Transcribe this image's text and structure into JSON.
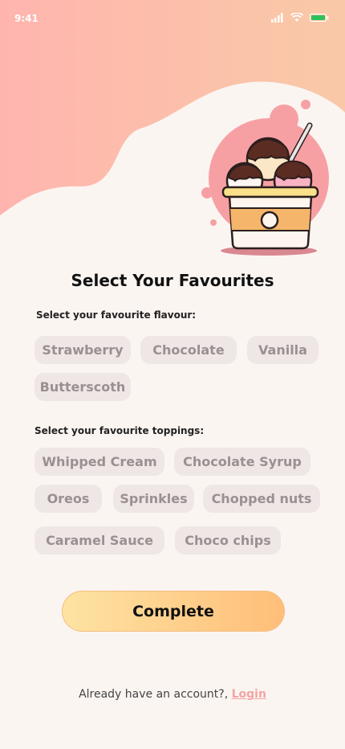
{
  "status_bar": {
    "time": "9:41",
    "icons": [
      "signal-icon",
      "wifi-icon",
      "battery-icon"
    ]
  },
  "colors": {
    "background": "#fbf5f2",
    "wave_gradient_start": "#ffb5ae",
    "wave_gradient_end": "#f9c9a7",
    "chip_background": "#efe6e6",
    "chip_text": "#9a8f91",
    "button_gradient_start": "#fde3a2",
    "button_gradient_end": "#ffbe79",
    "link": "#f4a3a3"
  },
  "illustration": {
    "icon": "ice-cream-cup-icon"
  },
  "title": "Select Your Favourites",
  "flavour_section": {
    "label": "Select your favourite flavour:",
    "options": [
      "Strawberry",
      "Chocolate",
      "Vanilla",
      "Butterscoth"
    ]
  },
  "toppings_section": {
    "label": "Select your favourite toppings:",
    "options": [
      "Whipped Cream",
      "Chocolate Syrup",
      "Oreos",
      "Sprinkles",
      "Chopped nuts",
      "Caramel Sauce",
      "Choco chips"
    ]
  },
  "complete_button": {
    "label": "Complete"
  },
  "footer": {
    "prompt": "Already have an account?, ",
    "login_label": "Login"
  }
}
